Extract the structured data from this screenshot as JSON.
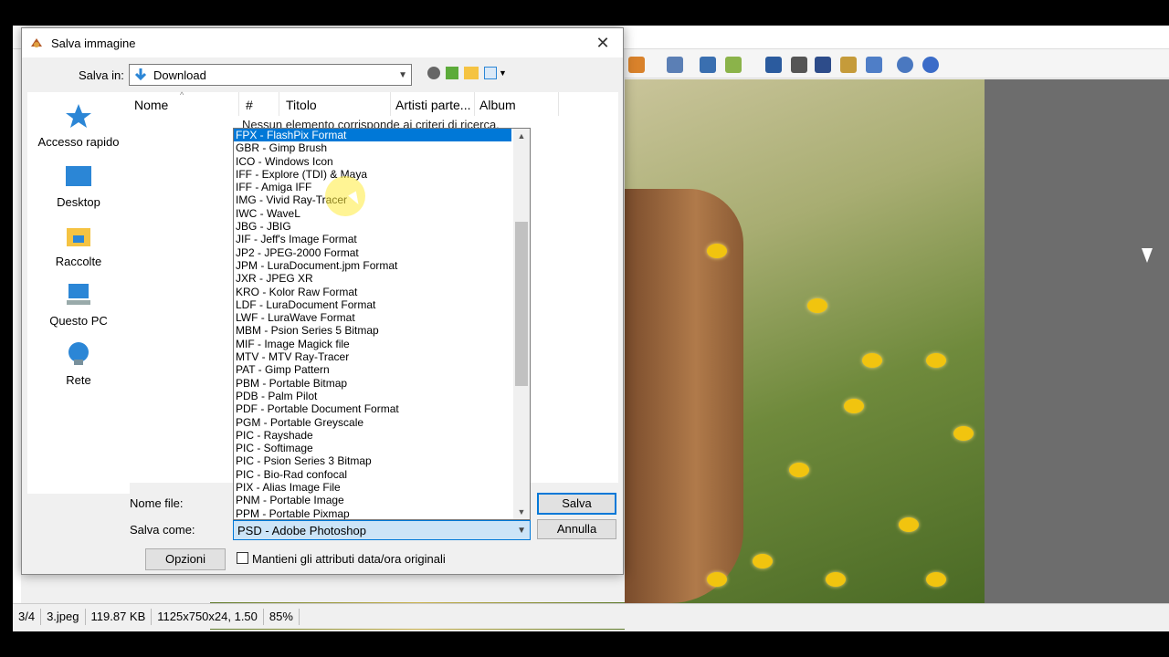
{
  "dialog": {
    "title": "Salva immagine",
    "save_in_label": "Salva in:",
    "save_in_value": "Download",
    "places": [
      "Accesso rapido",
      "Desktop",
      "Raccolte",
      "Questo PC",
      "Rete"
    ],
    "columns": [
      "Nome",
      "#",
      "Titolo",
      "Artisti parte...",
      "Album"
    ],
    "empty_message": "Nessun elemento corrisponde ai criteri di ricerca.",
    "filename_label": "Nome file:",
    "filetype_label": "Salva come:",
    "filetype_value": "PSD - Adobe Photoshop",
    "save_button": "Salva",
    "cancel_button": "Annulla",
    "options_button": "Opzioni",
    "keep_dates_label": "Mantieni gli attributi data/ora originali",
    "keep_dates_checked": false
  },
  "format_list": [
    "FPX - FlashPix Format",
    "GBR - Gimp Brush",
    "ICO - Windows Icon",
    "IFF - Explore (TDI) & Maya",
    "IFF - Amiga IFF",
    "IMG - Vivid Ray-Tracer",
    "IWC - WaveL",
    "JBG - JBIG",
    "JIF - Jeff's Image Format",
    "JP2 - JPEG-2000 Format",
    "JPM - LuraDocument.jpm Format",
    "JXR - JPEG XR",
    "KRO - Kolor Raw Format",
    "LDF - LuraDocument Format",
    "LWF - LuraWave Format",
    "MBM - Psion Series 5 Bitmap",
    "MIF - Image Magick file",
    "MTV - MTV Ray-Tracer",
    "PAT - Gimp Pattern",
    "PBM - Portable Bitmap",
    "PDB - Palm Pilot",
    "PDF - Portable Document Format",
    "PGM - Portable Greyscale",
    "PIC - Rayshade",
    "PIC - Softimage",
    "PIC - Psion Series 3 Bitmap",
    "PIC - Bio-Rad confocal",
    "PIX - Alias Image File",
    "PNM - Portable Image",
    "PPM - Portable Pixmap"
  ],
  "format_selected_index": 0,
  "status": {
    "position": "3/4",
    "filename": "3.jpeg",
    "size": "119.87 KB",
    "dimensions": "1125x750x24, 1.50",
    "zoom": "85%"
  },
  "colors": {
    "accent": "#0078d7",
    "icon_blue": "#2b86d6",
    "folder_yellow": "#f5c342"
  }
}
